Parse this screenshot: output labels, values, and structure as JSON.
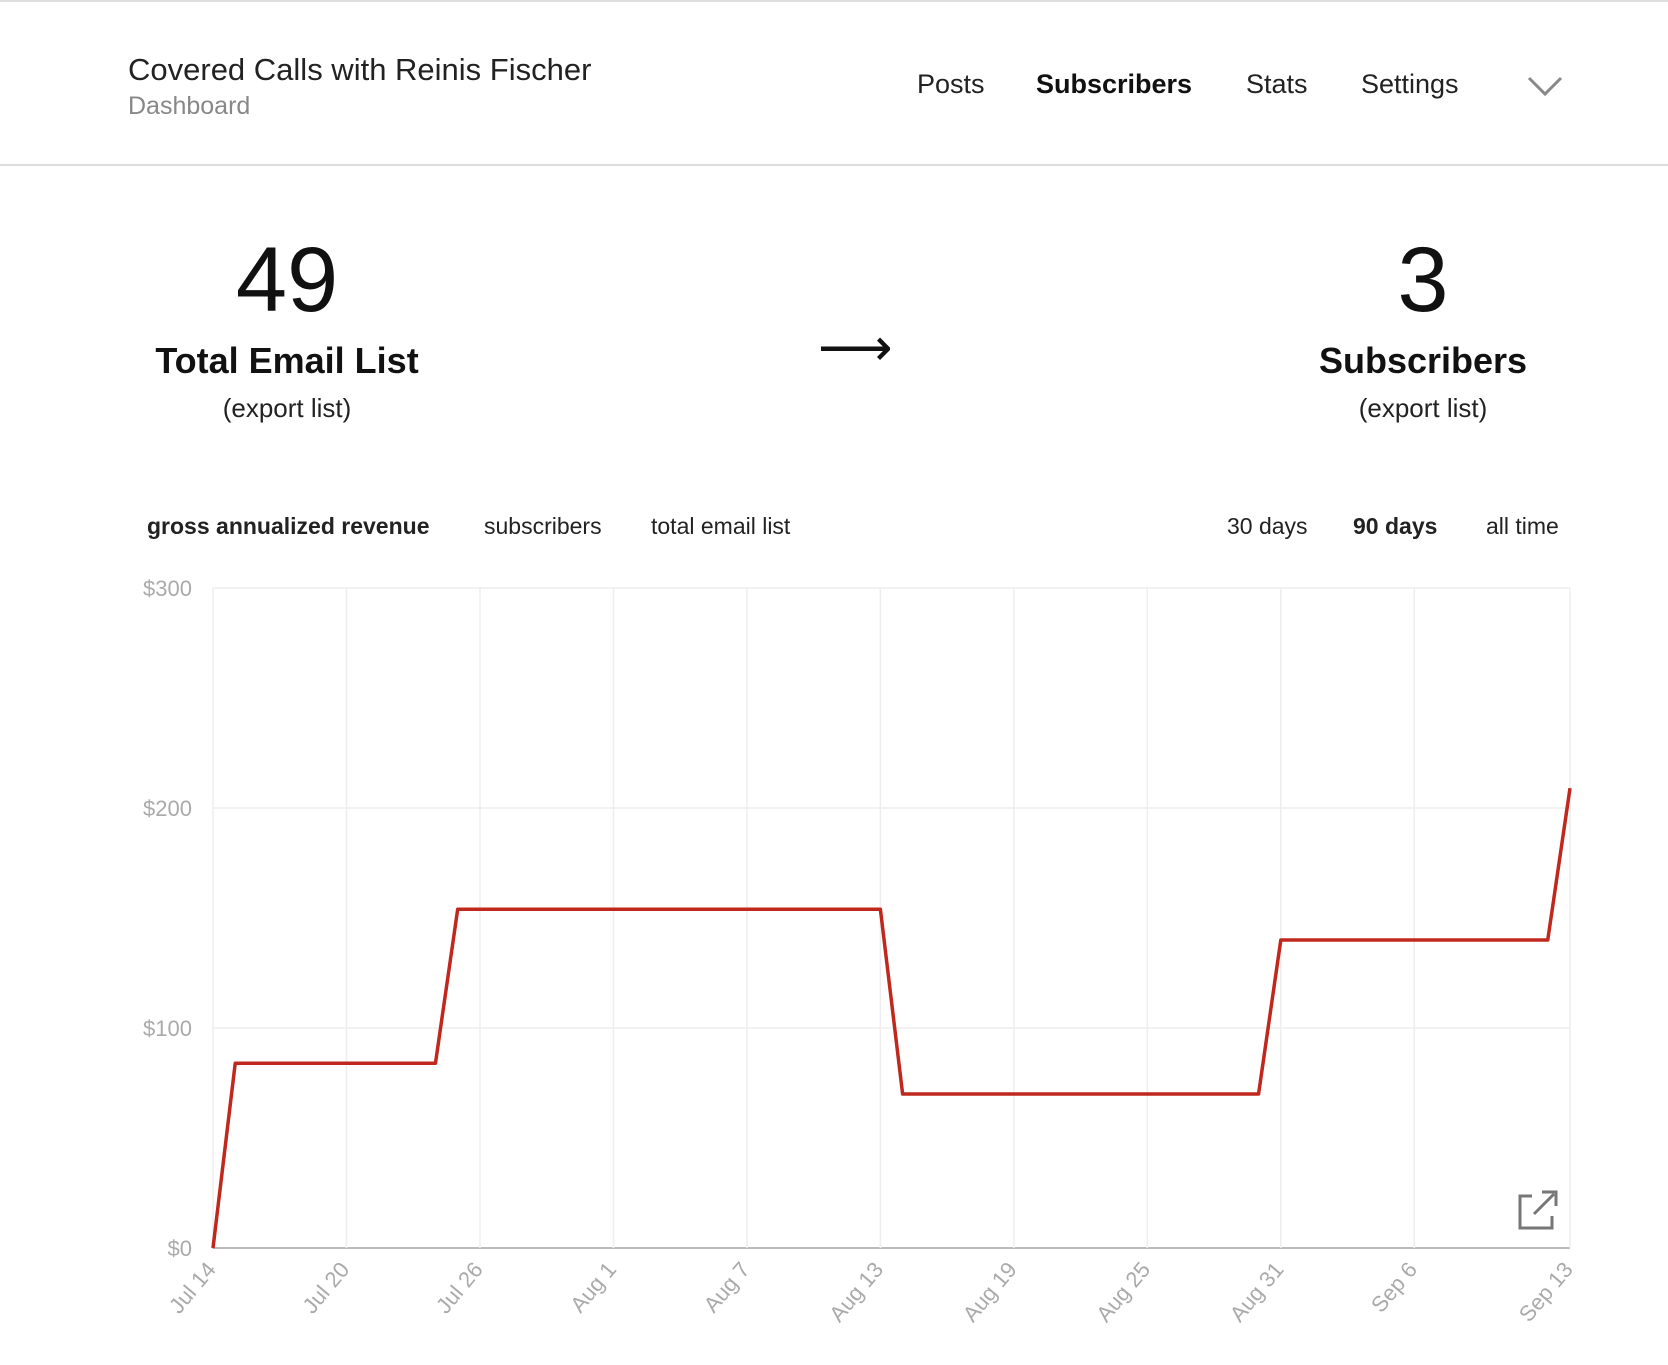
{
  "header": {
    "title": "Covered Calls with Reinis Fischer",
    "subtitle": "Dashboard",
    "nav": [
      {
        "label": "Posts",
        "active": false
      },
      {
        "label": "Subscribers",
        "active": true
      },
      {
        "label": "Stats",
        "active": false
      },
      {
        "label": "Settings",
        "active": false
      }
    ],
    "menu_icon": "chevron-down-icon"
  },
  "stats": {
    "left": {
      "value": "49",
      "label": "Total Email List",
      "link": "(export list)"
    },
    "arrow": "⟶",
    "right": {
      "value": "3",
      "label": "Subscribers",
      "link": "(export list)"
    }
  },
  "metric_tabs": [
    {
      "label": "gross annualized revenue",
      "active": true
    },
    {
      "label": "subscribers",
      "active": false
    },
    {
      "label": "total email list",
      "active": false
    }
  ],
  "range_tabs": [
    {
      "label": "30 days",
      "active": false
    },
    {
      "label": "90 days",
      "active": true
    },
    {
      "label": "all time",
      "active": false
    }
  ],
  "chart_data": {
    "type": "line",
    "color": "#c0281e",
    "ylim": [
      0,
      300
    ],
    "y_ticks": [
      "$0",
      "$100",
      "$200",
      "$300"
    ],
    "x_ticks": [
      "Jul 14",
      "Jul 20",
      "Jul 26",
      "Aug 1",
      "Aug 7",
      "Aug 13",
      "Aug 19",
      "Aug 25",
      "Aug 31",
      "Sep 6",
      "Sep 13"
    ],
    "x_range": [
      "Jul 14",
      "Sep 13"
    ],
    "grid": true,
    "points": [
      {
        "x": "Jul 14",
        "y": 0
      },
      {
        "x": "Jul 15",
        "y": 84
      },
      {
        "x": "Jul 24",
        "y": 84
      },
      {
        "x": "Jul 25",
        "y": 154
      },
      {
        "x": "Aug 13",
        "y": 154
      },
      {
        "x": "Aug 14",
        "y": 70
      },
      {
        "x": "Aug 30",
        "y": 70
      },
      {
        "x": "Aug 31",
        "y": 140
      },
      {
        "x": "Sep 12",
        "y": 140
      },
      {
        "x": "Sep 13",
        "y": 209
      }
    ],
    "export_icon": "external-link-icon"
  }
}
